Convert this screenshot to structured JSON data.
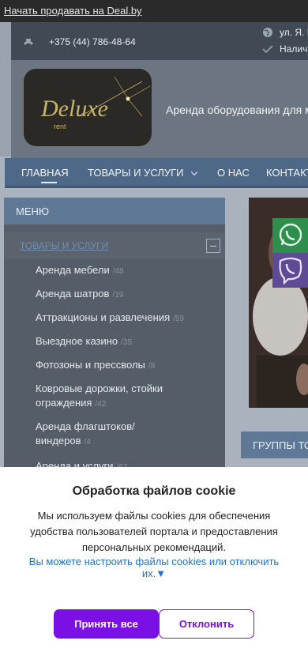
{
  "topbar": {
    "sell_link": "Начать продавать на Deal.by"
  },
  "contacts": {
    "phone": "+375 (44) 786-48-64",
    "address": "ул. Я. Ма",
    "availability": "Налич"
  },
  "header": {
    "tagline": "Аренда оборудования для ме",
    "logo_text": "Deluxe",
    "logo_sub": "rent"
  },
  "nav": {
    "items": [
      "ГЛАВНАЯ",
      "ТОВАРЫ И УСЛУГИ",
      "О НАС",
      "КОНТАКТЫ"
    ]
  },
  "sidebar": {
    "menu_title": "МЕНЮ",
    "category": "ТОВАРЫ И УСЛУГИ",
    "items": [
      {
        "label": "Аренда мебели",
        "count": "/48"
      },
      {
        "label": "Аренда шатров",
        "count": "/19"
      },
      {
        "label": "Аттракционы и развлечения",
        "count": "/59"
      },
      {
        "label": "Выездное казино",
        "count": "/35"
      },
      {
        "label": "Фотозоны и прессволы",
        "count": "/8"
      },
      {
        "label": "Ковровые дорожки, стойки ограждения",
        "count": "/42"
      },
      {
        "label": "Аренда флагштоков/ виндеров",
        "count": "/4"
      },
      {
        "label": "Аренда и услуги",
        "count": "/67"
      }
    ]
  },
  "groups": {
    "title": "ГРУППЫ ТО"
  },
  "cookie": {
    "title": "Обработка файлов cookie",
    "text": "Мы используем файлы cookies для обеспечения удобства пользователей портала и предоставления персональных рекомендаций.",
    "link": "Вы можете настроить файлы cookies или отключить их.▼",
    "accept": "Принять все",
    "decline": "Отклонить"
  },
  "colors": {
    "accent": "#7a10e6",
    "nav": "#4e6987",
    "link": "#1f6fd0"
  }
}
